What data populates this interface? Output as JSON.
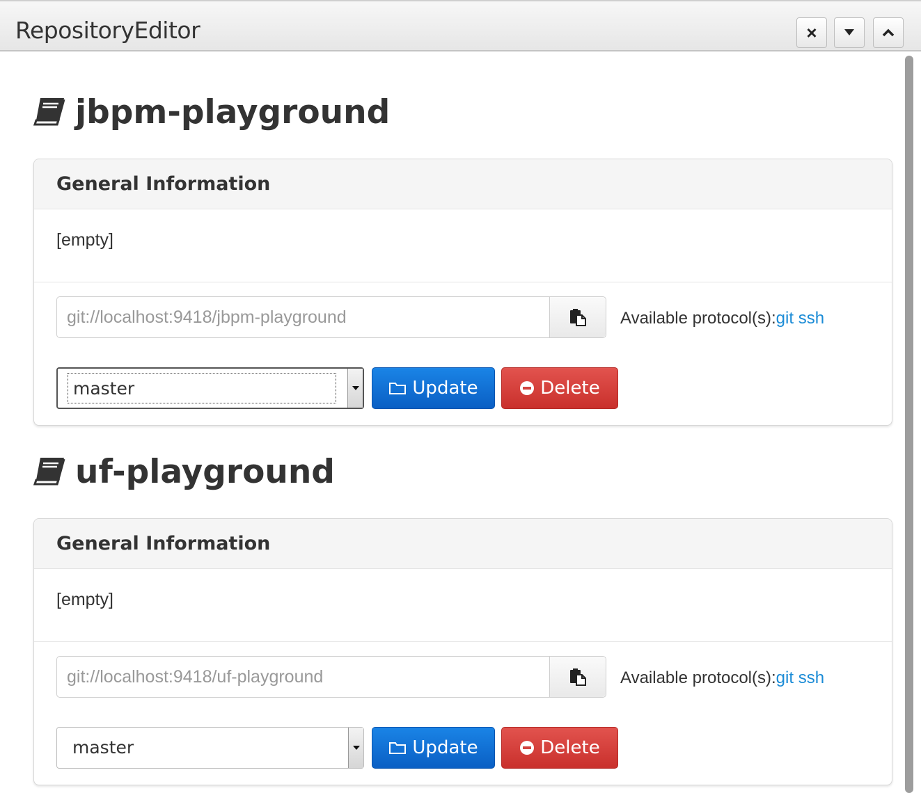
{
  "window": {
    "title": "RepositoryEditor",
    "controls": {
      "close": "×",
      "collapse": "▾",
      "maximize": "⌃"
    }
  },
  "repositories": [
    {
      "name": "jbpm-playground",
      "panel_heading": "General Information",
      "description": "[empty]",
      "url": "git://localhost:9418/jbpm-playground",
      "protocols_label": "Available protocol(s):",
      "protocols": [
        "git",
        "ssh"
      ],
      "branch": "master",
      "update_label": "Update",
      "delete_label": "Delete"
    },
    {
      "name": "uf-playground",
      "panel_heading": "General Information",
      "description": "[empty]",
      "url": "git://localhost:9418/uf-playground",
      "protocols_label": "Available protocol(s):",
      "protocols": [
        "git",
        "ssh"
      ],
      "branch": "master",
      "update_label": "Update",
      "delete_label": "Delete"
    }
  ],
  "icons": {
    "repo": "book-icon",
    "copy": "clipboard-icon",
    "update": "folder-icon",
    "delete": "minus-circle-icon"
  },
  "colors": {
    "update_button": "#0a6fd6",
    "delete_button": "#d9534f",
    "link": "#1a8bd6"
  }
}
